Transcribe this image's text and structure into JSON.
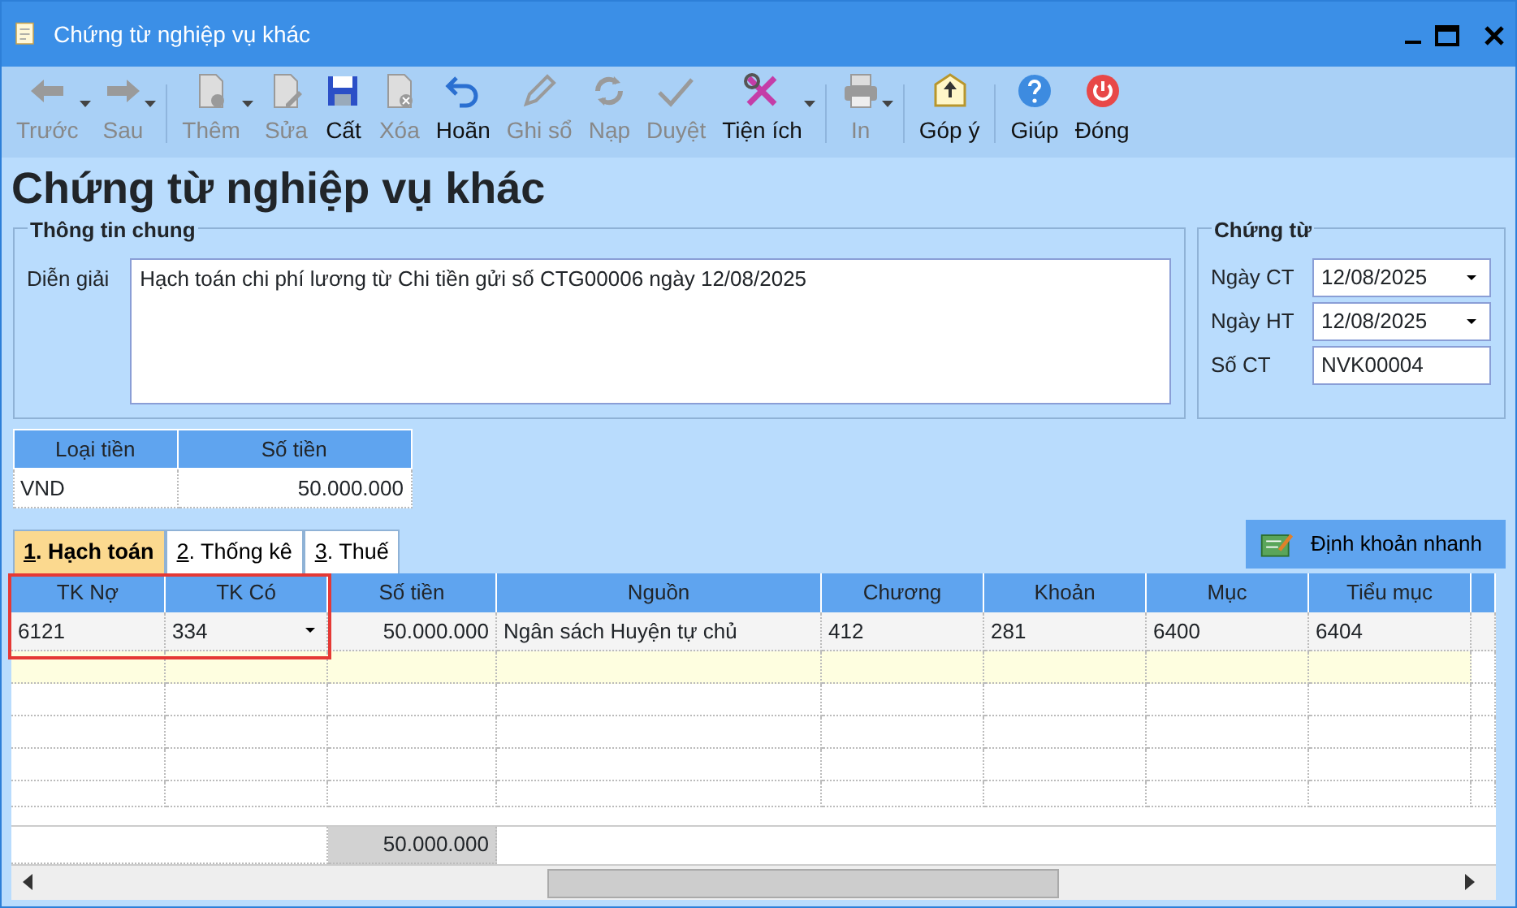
{
  "window": {
    "title": "Chứng từ nghiệp vụ khác"
  },
  "toolbar": [
    {
      "label": "Trước",
      "disabled": true,
      "dropdown": true,
      "separator_after": false
    },
    {
      "label": "Sau",
      "disabled": true,
      "dropdown": true,
      "separator_after": true
    },
    {
      "label": "Thêm",
      "disabled": true,
      "dropdown": true,
      "separator_after": false
    },
    {
      "label": "Sửa",
      "disabled": true,
      "dropdown": false,
      "separator_after": false
    },
    {
      "label": "Cất",
      "disabled": false,
      "dropdown": false,
      "separator_after": false
    },
    {
      "label": "Xóa",
      "disabled": true,
      "dropdown": false,
      "separator_after": false
    },
    {
      "label": "Hoãn",
      "disabled": false,
      "dropdown": false,
      "separator_after": false
    },
    {
      "label": "Ghi sổ",
      "disabled": true,
      "dropdown": false,
      "separator_after": false
    },
    {
      "label": "Nạp",
      "disabled": true,
      "dropdown": false,
      "separator_after": false
    },
    {
      "label": "Duyệt",
      "disabled": true,
      "dropdown": false,
      "separator_after": false
    },
    {
      "label": "Tiện ích",
      "disabled": false,
      "dropdown": true,
      "separator_after": true
    },
    {
      "label": "In",
      "disabled": true,
      "dropdown": true,
      "separator_after": true
    },
    {
      "label": "Góp ý",
      "disabled": false,
      "dropdown": false,
      "separator_after": true
    },
    {
      "label": "Giúp",
      "disabled": false,
      "dropdown": false,
      "separator_after": false
    },
    {
      "label": "Đóng",
      "disabled": false,
      "dropdown": false,
      "separator_after": false
    }
  ],
  "heading": "Chứng từ nghiệp vụ khác",
  "general": {
    "title": "Thông tin chung",
    "description_label": "Diễn giải",
    "description": "Hạch toán chi phí lương từ Chi tiền gửi số CTG00006 ngày 12/08/2025"
  },
  "voucher": {
    "title": "Chứng từ",
    "fields": [
      {
        "label": "Ngày CT",
        "value": "12/08/2025",
        "kind": "dropdown"
      },
      {
        "label": "Ngày HT",
        "value": "12/08/2025",
        "kind": "dropdown"
      },
      {
        "label": "Số CT",
        "value": "NVK00004",
        "kind": "text"
      }
    ]
  },
  "currency": {
    "columns": [
      "Loại tiền",
      "Số tiền"
    ],
    "rows": [
      [
        "VND",
        "50.000.000"
      ]
    ]
  },
  "tabs": [
    {
      "label": "1. Hạch toán",
      "selected": true
    },
    {
      "label": "2. Thống kê",
      "selected": false
    },
    {
      "label": "3. Thuế",
      "selected": false
    }
  ],
  "quick_button": "Định khoản nhanh",
  "grid": {
    "columns": [
      {
        "label": "TK Nợ",
        "highlighted": true
      },
      {
        "label": "TK Có",
        "highlighted": true
      },
      {
        "label": "Số tiền",
        "highlighted": false
      },
      {
        "label": "Nguồn",
        "highlighted": false
      },
      {
        "label": "Chương",
        "highlighted": false
      },
      {
        "label": "Khoản",
        "highlighted": false
      },
      {
        "label": "Mục",
        "highlighted": false
      },
      {
        "label": "Tiểu mục",
        "highlighted": false
      }
    ],
    "rows": [
      [
        "6121",
        "334",
        "50.000.000",
        "Ngân sách Huyện tự chủ",
        "412",
        "281",
        "6400",
        "6404"
      ]
    ],
    "total": "50.000.000"
  }
}
